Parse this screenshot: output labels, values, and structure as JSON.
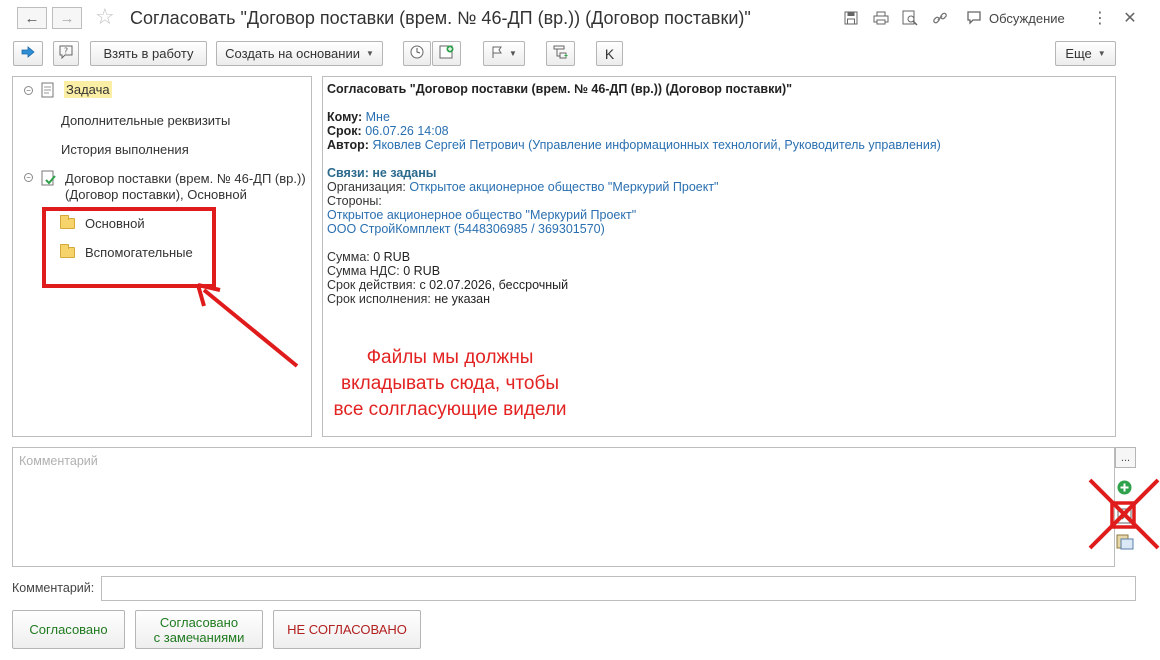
{
  "window": {
    "title": "Согласовать \"Договор поставки (врем. № 46-ДП (вр.)) (Договор поставки)\"",
    "discussion_label": "Обсуждение"
  },
  "toolbar": {
    "take_to_work": "Взять в работу",
    "create_based_on": "Создать на основании",
    "more": "Еще"
  },
  "tree": {
    "task": "Задача",
    "additional_details": "Дополнительные реквизиты",
    "history": "История выполнения",
    "contract_line1": "Договор поставки (врем. № 46-ДП (вр.))",
    "contract_line2": "(Договор поставки), Основной",
    "folder_main": "Основной",
    "folder_aux": "Вспомогательные"
  },
  "details": {
    "header": "Согласовать \"Договор поставки (врем. № 46-ДП (вр.)) (Договор поставки)\"",
    "to_label": "Кому:",
    "to_value": "Мне",
    "deadline_label": "Срок:",
    "deadline_value": "06.07.26 14:08",
    "author_label": "Автор:",
    "author_value": "Яковлев Сергей Петрович (Управление информационных технологий, Руководитель управления)",
    "links_title": "Связи: не заданы",
    "org_label": "Организация:",
    "org_value": "Открытое акционерное общество \"Меркурий Проект\"",
    "parties_label": "Стороны:",
    "party1": "Открытое акционерное общество \"Меркурий Проект\"",
    "party2": "ООО СтройКомплект (5448306985 / 369301570)",
    "sum_label": "Сумма:",
    "sum_value": "0 RUB",
    "vat_label": "Сумма НДС:",
    "vat_value": "0 RUB",
    "validity_label": "Срок действия:",
    "validity_value": "с 02.07.2026, бессрочный",
    "execution_label": "Срок исполнения:",
    "execution_value": "не указан"
  },
  "annotation": {
    "line1": "Файлы мы должны",
    "line2": "вкладывать сюда, чтобы",
    "line3": "все солгласующие видели"
  },
  "comment": {
    "placeholder": "Комментарий",
    "field_label": "Комментарий:",
    "field_value": ""
  },
  "buttons": {
    "approved": "Согласовано",
    "approved_remarks_line1": "Согласовано",
    "approved_remarks_line2": "с замечаниями",
    "not_approved": "НЕ СОГЛАСОВАНО"
  },
  "colors": {
    "approved_text": "#1f7a1f",
    "not_approved_text": "#b22020",
    "annotation_red": "#e32222",
    "link_blue": "#2a6fb0",
    "highlight_yellow": "#fbeea5"
  }
}
